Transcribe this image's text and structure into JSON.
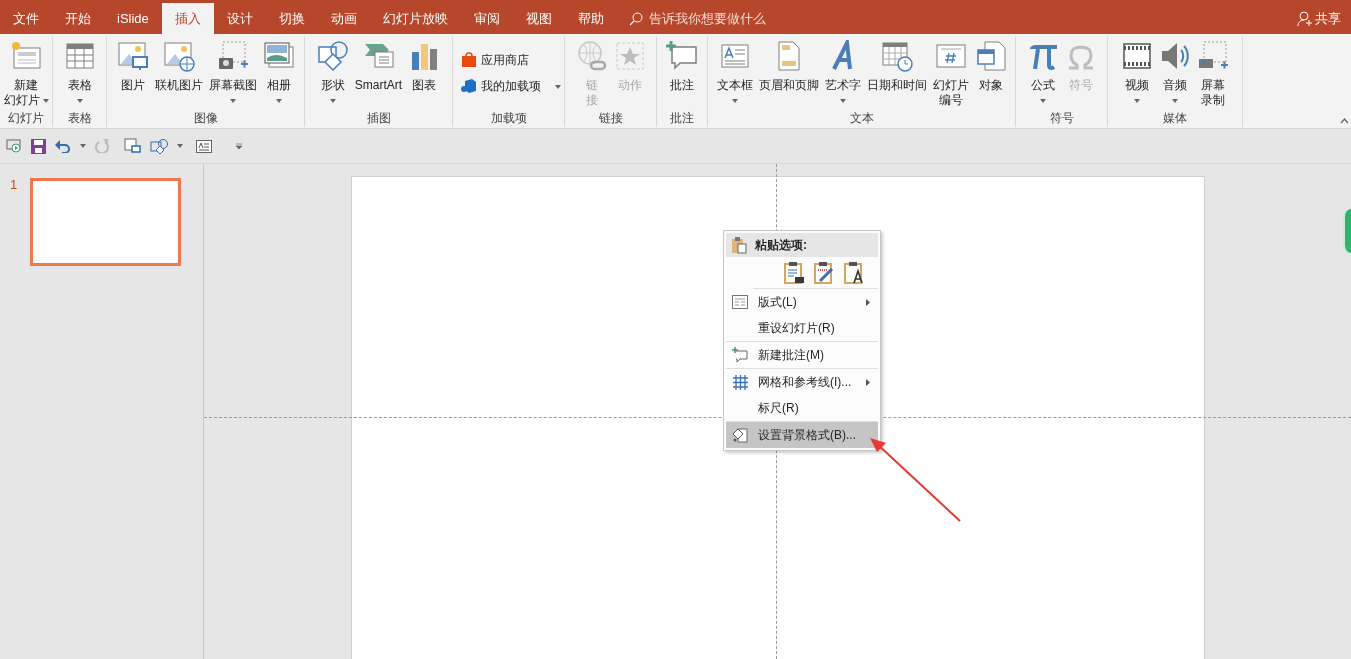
{
  "tabs": [
    {
      "label": "文件",
      "selected": false
    },
    {
      "label": "开始",
      "selected": false
    },
    {
      "label": "iSlide",
      "selected": false
    },
    {
      "label": "插入",
      "selected": true
    },
    {
      "label": "设计",
      "selected": false
    },
    {
      "label": "切换",
      "selected": false
    },
    {
      "label": "动画",
      "selected": false
    },
    {
      "label": "幻灯片放映",
      "selected": false
    },
    {
      "label": "审阅",
      "selected": false
    },
    {
      "label": "视图",
      "selected": false
    },
    {
      "label": "帮助",
      "selected": false
    }
  ],
  "tell_me": {
    "placeholder": "告诉我你想要做什么"
  },
  "share": "共享",
  "ribbon": {
    "groups": [
      {
        "label": "幻灯片",
        "commands": [
          {
            "kind": "large",
            "lines": [
              "新建",
              "幻灯片"
            ],
            "dropdown": true,
            "disabled": false
          }
        ]
      },
      {
        "label": "表格",
        "commands": [
          {
            "kind": "large",
            "lines": [
              "表格"
            ],
            "dropdown": true,
            "disabled": false
          }
        ]
      },
      {
        "label": "图像",
        "commands": [
          {
            "kind": "large",
            "lines": [
              "图片"
            ],
            "dropdown": false,
            "disabled": false
          },
          {
            "kind": "large",
            "lines": [
              "联机图片"
            ],
            "dropdown": false,
            "disabled": false
          },
          {
            "kind": "large",
            "lines": [
              "屏幕截图"
            ],
            "dropdown": true,
            "disabled": false
          },
          {
            "kind": "large",
            "lines": [
              "相册"
            ],
            "dropdown": true,
            "disabled": false
          }
        ]
      },
      {
        "label": "插图",
        "commands": [
          {
            "kind": "large",
            "lines": [
              "形状"
            ],
            "dropdown": true,
            "disabled": false
          },
          {
            "kind": "large",
            "lines": [
              "SmartArt"
            ],
            "dropdown": false,
            "disabled": false
          },
          {
            "kind": "large",
            "lines": [
              "图表"
            ],
            "dropdown": false,
            "disabled": false
          }
        ]
      },
      {
        "label": "加载项",
        "commands": [
          {
            "kind": "small",
            "lines": [
              "应用商店"
            ],
            "dropdown": false,
            "disabled": false
          },
          {
            "kind": "small",
            "lines": [
              "我的加载项"
            ],
            "dropdown": true,
            "disabled": false
          }
        ]
      },
      {
        "label": "链接",
        "commands": [
          {
            "kind": "large",
            "lines": [
              "链",
              "接"
            ],
            "dropdown": false,
            "disabled": true
          },
          {
            "kind": "large",
            "lines": [
              "动作"
            ],
            "dropdown": false,
            "disabled": true
          }
        ]
      },
      {
        "label": "批注",
        "commands": [
          {
            "kind": "large",
            "lines": [
              "批注"
            ],
            "dropdown": false,
            "disabled": false
          }
        ]
      },
      {
        "label": "文本",
        "commands": [
          {
            "kind": "large",
            "lines": [
              "文本框"
            ],
            "dropdown": true,
            "disabled": false
          },
          {
            "kind": "large",
            "lines": [
              "页眉和页脚"
            ],
            "dropdown": false,
            "disabled": false
          },
          {
            "kind": "large",
            "lines": [
              "艺术字"
            ],
            "dropdown": true,
            "disabled": false
          },
          {
            "kind": "large",
            "lines": [
              "日期和时间"
            ],
            "dropdown": false,
            "disabled": false
          },
          {
            "kind": "large",
            "lines": [
              "幻灯片",
              "编号"
            ],
            "dropdown": false,
            "disabled": false
          },
          {
            "kind": "large",
            "lines": [
              "对象"
            ],
            "dropdown": false,
            "disabled": false
          }
        ]
      },
      {
        "label": "符号",
        "commands": [
          {
            "kind": "large",
            "lines": [
              "公式"
            ],
            "dropdown": true,
            "disabled": false
          },
          {
            "kind": "large",
            "lines": [
              "符号"
            ],
            "dropdown": false,
            "disabled": true
          }
        ]
      },
      {
        "label": "媒体",
        "commands": [
          {
            "kind": "large",
            "lines": [
              "视频"
            ],
            "dropdown": true,
            "disabled": false
          },
          {
            "kind": "large",
            "lines": [
              "音频"
            ],
            "dropdown": true,
            "disabled": false
          },
          {
            "kind": "large",
            "lines": [
              "屏幕",
              "录制"
            ],
            "dropdown": false,
            "disabled": false
          }
        ]
      }
    ]
  },
  "slides": [
    {
      "number": "1",
      "selected": true
    }
  ],
  "context_menu": {
    "paste_header": "粘贴选项:",
    "sections": [
      [
        {
          "label": "版式(L)",
          "submenu": true,
          "selected": false
        },
        {
          "label": "重设幻灯片(R)",
          "submenu": false,
          "selected": false
        }
      ],
      [
        {
          "label": "新建批注(M)",
          "submenu": false,
          "selected": false
        }
      ],
      [
        {
          "label": "网格和参考线(I)...",
          "submenu": true,
          "selected": false
        },
        {
          "label": "标尺(R)",
          "submenu": false,
          "selected": false
        }
      ],
      [
        {
          "label": "设置背景格式(B)...",
          "submenu": false,
          "selected": true
        }
      ]
    ]
  }
}
